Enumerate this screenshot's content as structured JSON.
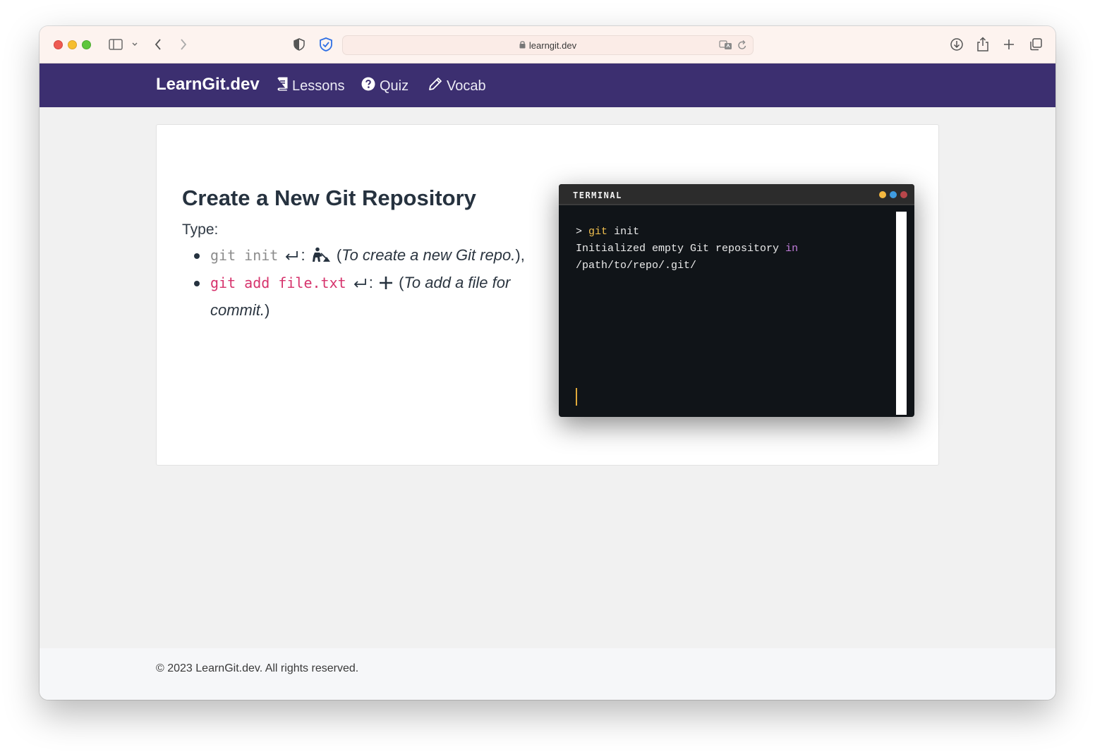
{
  "browser": {
    "url": "learngit.dev"
  },
  "navbar": {
    "brand": "LearnGit.dev",
    "items": [
      {
        "label": "Lessons",
        "icon": "book-icon"
      },
      {
        "label": "Quiz",
        "icon": "question-circle-icon"
      },
      {
        "label": "Vocab",
        "icon": "pencil-icon"
      }
    ]
  },
  "lesson": {
    "title": "Create a New Git Repository",
    "type_label": "Type:",
    "steps": [
      {
        "command": "git init",
        "separator": ":",
        "description": "To create a new Git repo.",
        "suffix": "),",
        "status": "completed",
        "icon": "digging-person-icon"
      },
      {
        "command": "git add file.txt",
        "separator": ":",
        "description": "To add a file for commit.",
        "suffix": ")",
        "status": "pending",
        "icon": "plus-icon"
      }
    ]
  },
  "terminal": {
    "title": "TERMINAL",
    "dot_colors": [
      "#f5b840",
      "#3f9be0",
      "#b8464a"
    ],
    "lines": {
      "prompt": ">",
      "command_keyword": "git",
      "command_rest": "init",
      "output_1_pre": "Initialized empty Git repository",
      "output_1_kw": "in",
      "output_2": "/path/to/repo/.git/"
    }
  },
  "footer": {
    "text": "© 2023 LearnGit.dev. All rights reserved."
  },
  "colors": {
    "navbar_bg": "#3c2f70",
    "command_pending": "#d6336c",
    "command_done": "#8c8c8c",
    "terminal_bg": "#101418"
  }
}
